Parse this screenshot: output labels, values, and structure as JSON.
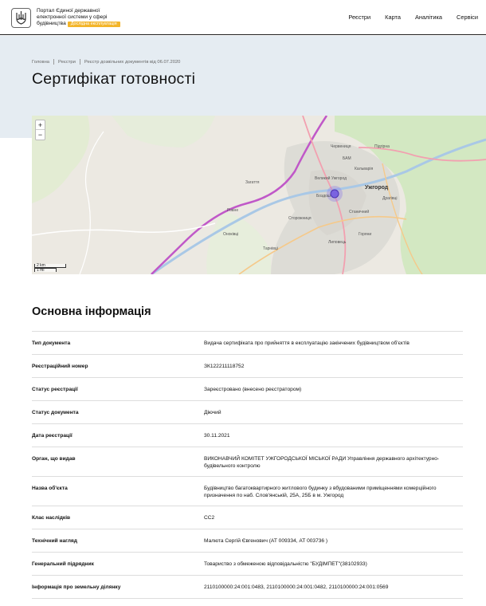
{
  "header": {
    "logo_line1": "Портал Єдиної державної",
    "logo_line2": "електронної системи у сфері",
    "logo_line3": "будівництва",
    "beta_label": "Дослідна експлуатація",
    "nav": [
      "Реєстри",
      "Карта",
      "Аналітика",
      "Сервіси"
    ]
  },
  "breadcrumb": [
    "Головна",
    "Реєстри",
    "Реєстр дозвільних документів від 06.07.2020"
  ],
  "page_title": "Сертифікат готовності",
  "map": {
    "zoom_in": "+",
    "zoom_out": "−",
    "scale_km": "2 km",
    "scale_mi": "1 mi",
    "labels": {
      "city": "Ужгород",
      "chervenytsia": "Червениця",
      "baм": "БАМ",
      "kalvariia": "Кальварія",
      "pidhiria": "Підгірна",
      "dravtsi": "Драгівці",
      "stanichnyi": "Станичний",
      "bozdosh": "Боздош",
      "verkhniy": "Великий Ужгород",
      "zheltvay": "Сторожниця",
      "lyhotka": "Липовець",
      "onokivtsi": "Оноківці",
      "tarnovtsi": "Тарнівці",
      "zahatia": "Загаття",
      "rovnye": "Ровне",
      "suhorony": "Горяни"
    }
  },
  "section_title": "Основна інформація",
  "info_rows": [
    {
      "label": "Тип документа",
      "value": "Видача сертифіката про прийняття в експлуатацію закінчених будівництвом об'єктів"
    },
    {
      "label": "Реєстраційний номер",
      "value": "ЗК122211118752"
    },
    {
      "label": "Статус реєстрації",
      "value": "Зареєстровано (внесено реєстратором)"
    },
    {
      "label": "Статус документа",
      "value": "Діючий"
    },
    {
      "label": "Дата реєстрації",
      "value": "30.11.2021"
    },
    {
      "label": "Орган, що видав",
      "value": "ВИКОНАВЧИЙ КОМІТЕТ УЖГОРОДСЬКОЇ МІСЬКОЇ РАДИ Управління державного архітектурно-будівельного контролю"
    },
    {
      "label": "Назва об'єкта",
      "value": "Будівництво багатоквартирного житлового будинку з вбудованими приміщеннями комерційного призначення по наб. Слов'янській, 25А, 25Б в м. Ужгород"
    },
    {
      "label": "Клас наслідків",
      "value": "СС2"
    },
    {
      "label": "Технічний нагляд",
      "value": "Малюта Сергій Євгенович (АТ 009334, АТ 003736 )"
    },
    {
      "label": "Генеральний підрядник",
      "value": "Товариство з обмеженою відповідальністю \"БУДІМПЕТ\"(38102933)"
    },
    {
      "label": "Інформація про земельну ділянку",
      "value": "2110100000:24:001:0483, 2110100000:24:001:0482, 2110100000:24:001:0569"
    }
  ]
}
